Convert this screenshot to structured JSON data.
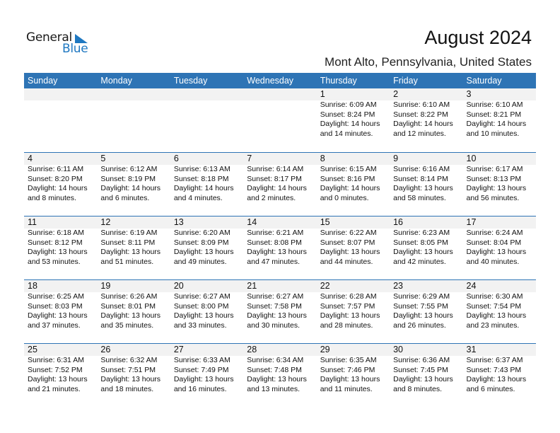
{
  "logo": {
    "word1": "General",
    "word2": "Blue"
  },
  "header": {
    "title": "August 2024",
    "subtitle": "Mont Alto, Pennsylvania, United States"
  },
  "colors": {
    "accent": "#2e74b5",
    "stripe": "#f2f2f2",
    "logo_blue": "#1f78c1"
  },
  "weekdays": [
    "Sunday",
    "Monday",
    "Tuesday",
    "Wednesday",
    "Thursday",
    "Friday",
    "Saturday"
  ],
  "weeks": [
    [
      null,
      null,
      null,
      null,
      {
        "day": "1",
        "sunrise": "Sunrise: 6:09 AM",
        "sunset": "Sunset: 8:24 PM",
        "daylight1": "Daylight: 14 hours",
        "daylight2": "and 14 minutes."
      },
      {
        "day": "2",
        "sunrise": "Sunrise: 6:10 AM",
        "sunset": "Sunset: 8:22 PM",
        "daylight1": "Daylight: 14 hours",
        "daylight2": "and 12 minutes."
      },
      {
        "day": "3",
        "sunrise": "Sunrise: 6:10 AM",
        "sunset": "Sunset: 8:21 PM",
        "daylight1": "Daylight: 14 hours",
        "daylight2": "and 10 minutes."
      }
    ],
    [
      {
        "day": "4",
        "sunrise": "Sunrise: 6:11 AM",
        "sunset": "Sunset: 8:20 PM",
        "daylight1": "Daylight: 14 hours",
        "daylight2": "and 8 minutes."
      },
      {
        "day": "5",
        "sunrise": "Sunrise: 6:12 AM",
        "sunset": "Sunset: 8:19 PM",
        "daylight1": "Daylight: 14 hours",
        "daylight2": "and 6 minutes."
      },
      {
        "day": "6",
        "sunrise": "Sunrise: 6:13 AM",
        "sunset": "Sunset: 8:18 PM",
        "daylight1": "Daylight: 14 hours",
        "daylight2": "and 4 minutes."
      },
      {
        "day": "7",
        "sunrise": "Sunrise: 6:14 AM",
        "sunset": "Sunset: 8:17 PM",
        "daylight1": "Daylight: 14 hours",
        "daylight2": "and 2 minutes."
      },
      {
        "day": "8",
        "sunrise": "Sunrise: 6:15 AM",
        "sunset": "Sunset: 8:16 PM",
        "daylight1": "Daylight: 14 hours",
        "daylight2": "and 0 minutes."
      },
      {
        "day": "9",
        "sunrise": "Sunrise: 6:16 AM",
        "sunset": "Sunset: 8:14 PM",
        "daylight1": "Daylight: 13 hours",
        "daylight2": "and 58 minutes."
      },
      {
        "day": "10",
        "sunrise": "Sunrise: 6:17 AM",
        "sunset": "Sunset: 8:13 PM",
        "daylight1": "Daylight: 13 hours",
        "daylight2": "and 56 minutes."
      }
    ],
    [
      {
        "day": "11",
        "sunrise": "Sunrise: 6:18 AM",
        "sunset": "Sunset: 8:12 PM",
        "daylight1": "Daylight: 13 hours",
        "daylight2": "and 53 minutes."
      },
      {
        "day": "12",
        "sunrise": "Sunrise: 6:19 AM",
        "sunset": "Sunset: 8:11 PM",
        "daylight1": "Daylight: 13 hours",
        "daylight2": "and 51 minutes."
      },
      {
        "day": "13",
        "sunrise": "Sunrise: 6:20 AM",
        "sunset": "Sunset: 8:09 PM",
        "daylight1": "Daylight: 13 hours",
        "daylight2": "and 49 minutes."
      },
      {
        "day": "14",
        "sunrise": "Sunrise: 6:21 AM",
        "sunset": "Sunset: 8:08 PM",
        "daylight1": "Daylight: 13 hours",
        "daylight2": "and 47 minutes."
      },
      {
        "day": "15",
        "sunrise": "Sunrise: 6:22 AM",
        "sunset": "Sunset: 8:07 PM",
        "daylight1": "Daylight: 13 hours",
        "daylight2": "and 44 minutes."
      },
      {
        "day": "16",
        "sunrise": "Sunrise: 6:23 AM",
        "sunset": "Sunset: 8:05 PM",
        "daylight1": "Daylight: 13 hours",
        "daylight2": "and 42 minutes."
      },
      {
        "day": "17",
        "sunrise": "Sunrise: 6:24 AM",
        "sunset": "Sunset: 8:04 PM",
        "daylight1": "Daylight: 13 hours",
        "daylight2": "and 40 minutes."
      }
    ],
    [
      {
        "day": "18",
        "sunrise": "Sunrise: 6:25 AM",
        "sunset": "Sunset: 8:03 PM",
        "daylight1": "Daylight: 13 hours",
        "daylight2": "and 37 minutes."
      },
      {
        "day": "19",
        "sunrise": "Sunrise: 6:26 AM",
        "sunset": "Sunset: 8:01 PM",
        "daylight1": "Daylight: 13 hours",
        "daylight2": "and 35 minutes."
      },
      {
        "day": "20",
        "sunrise": "Sunrise: 6:27 AM",
        "sunset": "Sunset: 8:00 PM",
        "daylight1": "Daylight: 13 hours",
        "daylight2": "and 33 minutes."
      },
      {
        "day": "21",
        "sunrise": "Sunrise: 6:27 AM",
        "sunset": "Sunset: 7:58 PM",
        "daylight1": "Daylight: 13 hours",
        "daylight2": "and 30 minutes."
      },
      {
        "day": "22",
        "sunrise": "Sunrise: 6:28 AM",
        "sunset": "Sunset: 7:57 PM",
        "daylight1": "Daylight: 13 hours",
        "daylight2": "and 28 minutes."
      },
      {
        "day": "23",
        "sunrise": "Sunrise: 6:29 AM",
        "sunset": "Sunset: 7:55 PM",
        "daylight1": "Daylight: 13 hours",
        "daylight2": "and 26 minutes."
      },
      {
        "day": "24",
        "sunrise": "Sunrise: 6:30 AM",
        "sunset": "Sunset: 7:54 PM",
        "daylight1": "Daylight: 13 hours",
        "daylight2": "and 23 minutes."
      }
    ],
    [
      {
        "day": "25",
        "sunrise": "Sunrise: 6:31 AM",
        "sunset": "Sunset: 7:52 PM",
        "daylight1": "Daylight: 13 hours",
        "daylight2": "and 21 minutes."
      },
      {
        "day": "26",
        "sunrise": "Sunrise: 6:32 AM",
        "sunset": "Sunset: 7:51 PM",
        "daylight1": "Daylight: 13 hours",
        "daylight2": "and 18 minutes."
      },
      {
        "day": "27",
        "sunrise": "Sunrise: 6:33 AM",
        "sunset": "Sunset: 7:49 PM",
        "daylight1": "Daylight: 13 hours",
        "daylight2": "and 16 minutes."
      },
      {
        "day": "28",
        "sunrise": "Sunrise: 6:34 AM",
        "sunset": "Sunset: 7:48 PM",
        "daylight1": "Daylight: 13 hours",
        "daylight2": "and 13 minutes."
      },
      {
        "day": "29",
        "sunrise": "Sunrise: 6:35 AM",
        "sunset": "Sunset: 7:46 PM",
        "daylight1": "Daylight: 13 hours",
        "daylight2": "and 11 minutes."
      },
      {
        "day": "30",
        "sunrise": "Sunrise: 6:36 AM",
        "sunset": "Sunset: 7:45 PM",
        "daylight1": "Daylight: 13 hours",
        "daylight2": "and 8 minutes."
      },
      {
        "day": "31",
        "sunrise": "Sunrise: 6:37 AM",
        "sunset": "Sunset: 7:43 PM",
        "daylight1": "Daylight: 13 hours",
        "daylight2": "and 6 minutes."
      }
    ]
  ]
}
